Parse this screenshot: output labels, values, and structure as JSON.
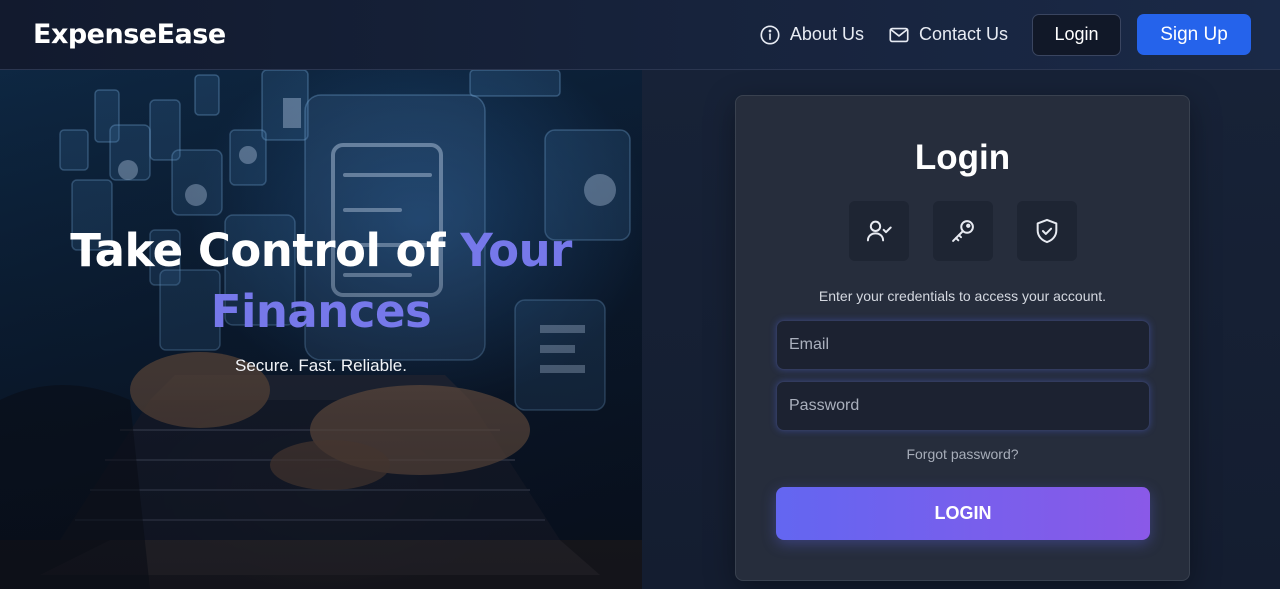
{
  "header": {
    "brand": "ExpenseEase",
    "nav": [
      {
        "label": "About Us",
        "icon": "info-circle-icon"
      },
      {
        "label": "Contact Us",
        "icon": "mail-icon"
      }
    ],
    "login_label": "Login",
    "signup_label": "Sign Up"
  },
  "hero": {
    "title_line1_white": "Take Control of ",
    "title_line1_accent": "Your",
    "title_line2_accent": "Finances",
    "subtitle": "Secure. Fast. Reliable."
  },
  "login_card": {
    "title": "Login",
    "icons": [
      "user-check-icon",
      "key-icon",
      "shield-check-icon"
    ],
    "description": "Enter your credentials to access your account.",
    "email_placeholder": "Email",
    "password_placeholder": "Password",
    "forgot_label": "Forgot password?",
    "submit_label": "LOGIN"
  },
  "colors": {
    "accent": "#7678ea",
    "signup_button": "#2563eb",
    "login_gradient_start": "#6366f1",
    "login_gradient_end": "#8a59e8",
    "card_background": "#262d3c"
  }
}
